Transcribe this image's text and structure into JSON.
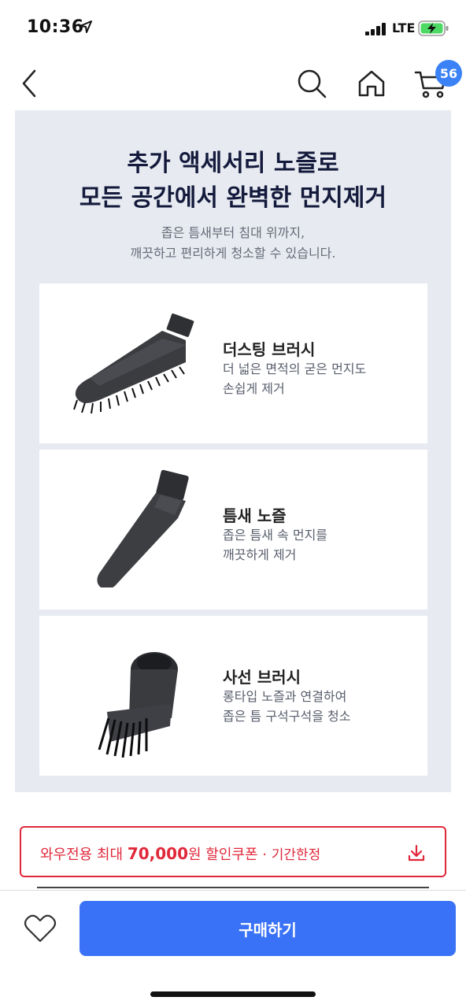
{
  "status": {
    "time": "10:36",
    "network": "LTE",
    "icons": [
      "location-arrow-icon",
      "signal-icon",
      "battery-charging-icon"
    ]
  },
  "nav": {
    "icons": [
      "back-icon",
      "search-icon",
      "home-icon",
      "cart-icon"
    ],
    "cart_count": "56"
  },
  "promo": {
    "headline_line1": "추가 액세서리 노즐로",
    "headline_line2": "모든 공간에서 완벽한 먼지제거",
    "sub_line1": "좁은 틈새부터 침대 위까지,",
    "sub_line2": "깨끗하고 편리하게 청소할 수 있습니다.",
    "items": [
      {
        "title": "더스팅 브러시",
        "desc_line1": "더 넓은 면적의 굳은 먼지도",
        "desc_line2": "손쉽게 제거",
        "image": "dusting-brush-image"
      },
      {
        "title": "틈새 노즐",
        "desc_line1": "좁은 틈새 속 먼지를",
        "desc_line2": "깨끗하게 제거",
        "image": "crevice-nozzle-image"
      },
      {
        "title": "사선 브러시",
        "desc_line1": "롱타입 노즐과 연결하여",
        "desc_line2": "좁은 틈 구석구석을 청소",
        "image": "angled-brush-image"
      }
    ]
  },
  "coupon": {
    "prefix": "와우전용 최대 ",
    "amount": "70,000",
    "suffix": "원 할인쿠폰",
    "separator": " · ",
    "limited": "기간한정",
    "icon": "download-icon"
  },
  "bottom": {
    "buy_label": "구매하기",
    "icon": "heart-icon"
  },
  "colors": {
    "accent": "#3a72f7",
    "coupon_red": "#e0283a",
    "panel_bg": "#e7ebf1",
    "headline": "#141a3c"
  }
}
